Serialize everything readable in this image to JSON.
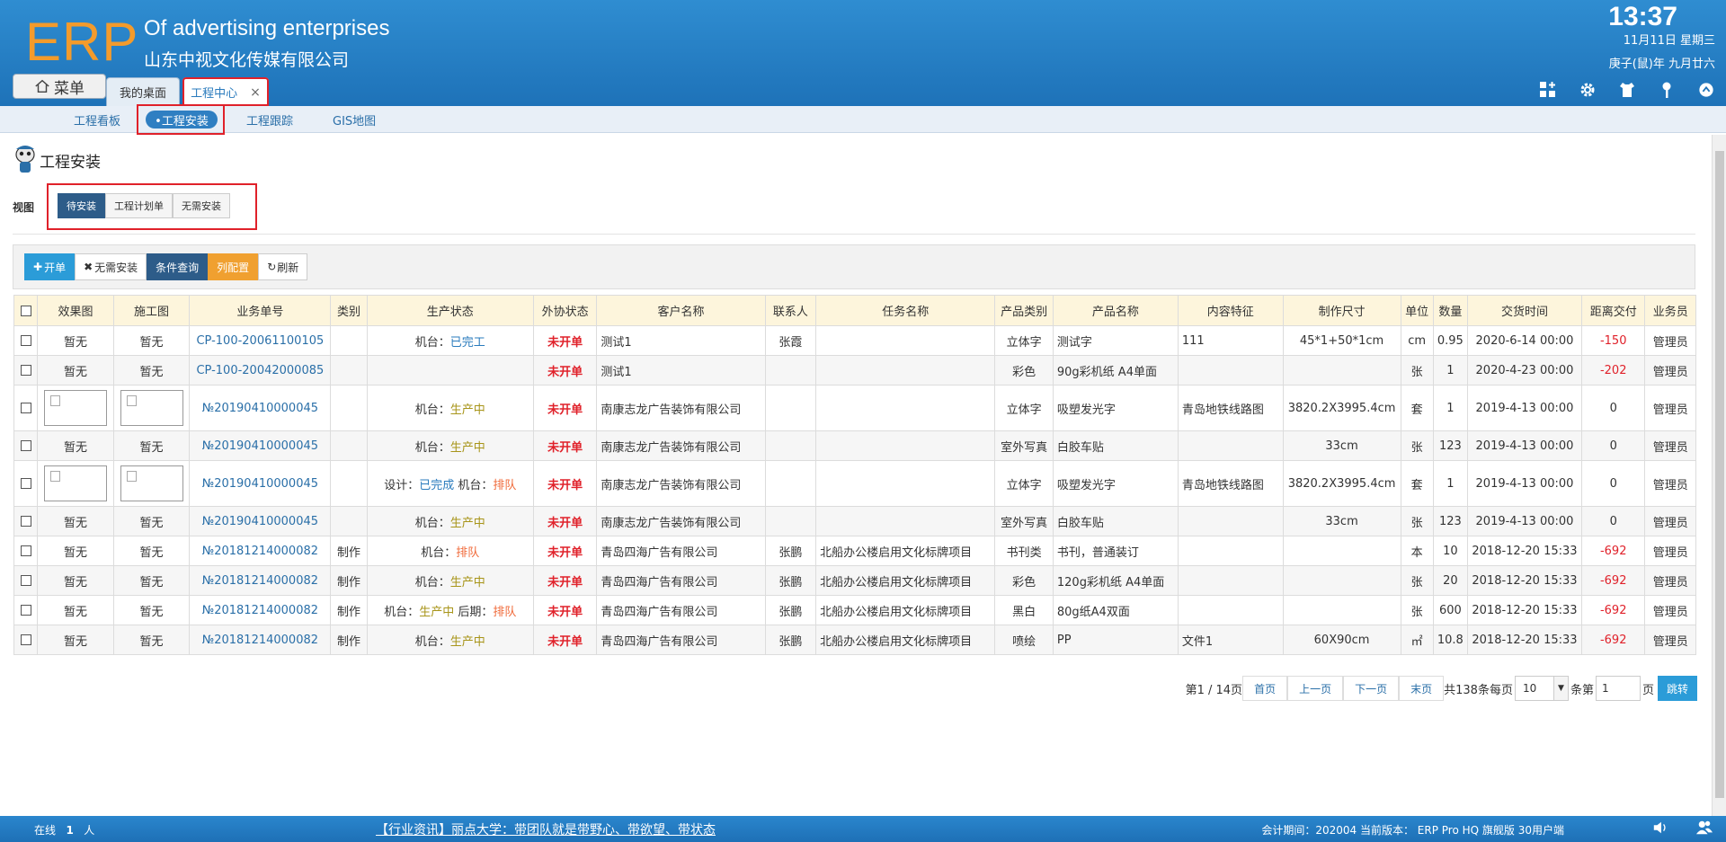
{
  "header": {
    "logo": "ERP",
    "company_en": "Of advertising enterprises",
    "company_cn": "山东中视文化传媒有限公司",
    "time": "13:37",
    "date_line1": "11月11日 星期三",
    "date_line2": "庚子(鼠)年 九月廿六",
    "menu_label": "菜单",
    "tabs": [
      {
        "label": "我的桌面"
      },
      {
        "label": "工程中心",
        "close": "×"
      }
    ],
    "icons": [
      "grid-add-icon",
      "gear-icon",
      "shirt-icon",
      "key-icon",
      "chevron-up-icon"
    ]
  },
  "subnav": {
    "items": [
      "工程看板",
      "•工程安装",
      "工程跟踪",
      "GIS地图"
    ],
    "active_index": 1
  },
  "page": {
    "title": "工程安装",
    "view_label": "视图",
    "views": [
      "待安装",
      "工程计划单",
      "无需安装"
    ],
    "active_view": 0
  },
  "toolbar": {
    "open": "开单",
    "no_install": "无需安装",
    "query": "条件查询",
    "columns": "列配置",
    "refresh": "刷新"
  },
  "table": {
    "headers": [
      "效果图",
      "施工图",
      "业务单号",
      "类别",
      "生产状态",
      "外协状态",
      "客户名称",
      "联系人",
      "任务名称",
      "产品类别",
      "产品名称",
      "内容特征",
      "制作尺寸",
      "单位",
      "数量",
      "交货时间",
      "距离交付",
      "业务员"
    ],
    "rows": [
      {
        "effect": "暂无",
        "construct": "暂无",
        "order": "CP-100-20061100105",
        "cat": "",
        "status_parts": [
          {
            "t": "机台：",
            "c": ""
          },
          {
            "t": "已完工",
            "c": "blue"
          }
        ],
        "outsource": "未开单",
        "customer": "测试1",
        "contact": "张霞",
        "task": "",
        "pcat": "立体字",
        "pname": "测试字",
        "feature": "111",
        "size": "45*1+50*1cm",
        "unit": "cm",
        "qty": "0.95",
        "delivery": "2020-6-14 00:00",
        "days": "-150",
        "sales": "管理员"
      },
      {
        "effect": "暂无",
        "construct": "暂无",
        "order": "CP-100-20042000085",
        "cat": "",
        "status_parts": [],
        "outsource": "未开单",
        "customer": "测试1",
        "contact": "",
        "task": "",
        "pcat": "彩色",
        "pname": "90g彩机纸 A4单面",
        "feature": "",
        "size": "",
        "unit": "张",
        "qty": "1",
        "delivery": "2020-4-23 00:00",
        "days": "-202",
        "sales": "管理员"
      },
      {
        "effect": "",
        "construct": "",
        "thumbs": true,
        "order": "№20190410000045",
        "cat": "",
        "status_parts": [
          {
            "t": "机台：",
            "c": ""
          },
          {
            "t": "生产中",
            "c": "olive"
          }
        ],
        "outsource": "未开单",
        "customer": "南康志龙广告装饰有限公司",
        "contact": "",
        "task": "",
        "pcat": "立体字",
        "pname": "吸塑发光字",
        "feature": "青岛地铁线路图",
        "size": "3820.2X3995.4cm",
        "unit": "套",
        "qty": "1",
        "delivery": "2019-4-13 00:00",
        "days": "0",
        "sales": "管理员"
      },
      {
        "effect": "暂无",
        "construct": "暂无",
        "order": "№20190410000045",
        "cat": "",
        "status_parts": [
          {
            "t": "机台：",
            "c": ""
          },
          {
            "t": "生产中",
            "c": "olive"
          }
        ],
        "outsource": "未开单",
        "customer": "南康志龙广告装饰有限公司",
        "contact": "",
        "task": "",
        "pcat": "室外写真",
        "pname": "白胶车贴",
        "feature": "",
        "size": "33cm",
        "unit": "张",
        "qty": "123",
        "delivery": "2019-4-13 00:00",
        "days": "0",
        "sales": "管理员"
      },
      {
        "effect": "",
        "construct": "",
        "thumbs": true,
        "order": "№20190410000045",
        "cat": "",
        "status_parts": [
          {
            "t": "设计：",
            "c": ""
          },
          {
            "t": "已完成",
            "c": "blue"
          },
          {
            "t": " 机台：",
            "c": ""
          },
          {
            "t": "排队",
            "c": "orange"
          }
        ],
        "outsource": "未开单",
        "customer": "南康志龙广告装饰有限公司",
        "contact": "",
        "task": "",
        "pcat": "立体字",
        "pname": "吸塑发光字",
        "feature": "青岛地铁线路图",
        "size": "3820.2X3995.4cm",
        "unit": "套",
        "qty": "1",
        "delivery": "2019-4-13 00:00",
        "days": "0",
        "sales": "管理员"
      },
      {
        "effect": "暂无",
        "construct": "暂无",
        "order": "№20190410000045",
        "cat": "",
        "status_parts": [
          {
            "t": "机台：",
            "c": ""
          },
          {
            "t": "生产中",
            "c": "olive"
          }
        ],
        "outsource": "未开单",
        "customer": "南康志龙广告装饰有限公司",
        "contact": "",
        "task": "",
        "pcat": "室外写真",
        "pname": "白胶车贴",
        "feature": "",
        "size": "33cm",
        "unit": "张",
        "qty": "123",
        "delivery": "2019-4-13 00:00",
        "days": "0",
        "sales": "管理员"
      },
      {
        "effect": "暂无",
        "construct": "暂无",
        "order": "№20181214000082",
        "cat": "制作",
        "status_parts": [
          {
            "t": "机台：",
            "c": ""
          },
          {
            "t": "排队",
            "c": "orange"
          }
        ],
        "outsource": "未开单",
        "customer": "青岛四海广告有限公司",
        "contact": "张鹏",
        "task": "北船办公楼启用文化标牌项目",
        "pcat": "书刊类",
        "pname": "书刊，普通装订",
        "feature": "",
        "size": "",
        "unit": "本",
        "qty": "10",
        "delivery": "2018-12-20 15:33",
        "days": "-692",
        "sales": "管理员"
      },
      {
        "effect": "暂无",
        "construct": "暂无",
        "order": "№20181214000082",
        "cat": "制作",
        "status_parts": [
          {
            "t": "机台：",
            "c": ""
          },
          {
            "t": "生产中",
            "c": "olive"
          }
        ],
        "outsource": "未开单",
        "customer": "青岛四海广告有限公司",
        "contact": "张鹏",
        "task": "北船办公楼启用文化标牌项目",
        "pcat": "彩色",
        "pname": "120g彩机纸 A4单面",
        "feature": "",
        "size": "",
        "unit": "张",
        "qty": "20",
        "delivery": "2018-12-20 15:33",
        "days": "-692",
        "sales": "管理员"
      },
      {
        "effect": "暂无",
        "construct": "暂无",
        "order": "№20181214000082",
        "cat": "制作",
        "status_parts": [
          {
            "t": "机台：",
            "c": ""
          },
          {
            "t": "生产中",
            "c": "olive"
          },
          {
            "t": " 后期：",
            "c": ""
          },
          {
            "t": "排队",
            "c": "orange"
          }
        ],
        "outsource": "未开单",
        "customer": "青岛四海广告有限公司",
        "contact": "张鹏",
        "task": "北船办公楼启用文化标牌项目",
        "pcat": "黑白",
        "pname": "80g纸A4双面",
        "feature": "",
        "size": "",
        "unit": "张",
        "qty": "600",
        "delivery": "2018-12-20 15:33",
        "days": "-692",
        "sales": "管理员"
      },
      {
        "effect": "暂无",
        "construct": "暂无",
        "order": "№20181214000082",
        "cat": "制作",
        "status_parts": [
          {
            "t": "机台：",
            "c": ""
          },
          {
            "t": "生产中",
            "c": "olive"
          }
        ],
        "outsource": "未开单",
        "customer": "青岛四海广告有限公司",
        "contact": "张鹏",
        "task": "北船办公楼启用文化标牌项目",
        "pcat": "喷绘",
        "pname": "PP",
        "feature": "文件1",
        "size": "60X90cm",
        "unit": "㎡",
        "qty": "10.8",
        "delivery": "2018-12-20 15:33",
        "days": "-692",
        "sales": "管理员"
      }
    ]
  },
  "pager": {
    "page_info": "第1 / 14页",
    "first": "首页",
    "prev": "上一页",
    "next": "下一页",
    "last": "末页",
    "total": "共138条每页",
    "per_page": "10",
    "goto_prefix": "条第",
    "goto_value": "1",
    "goto_suffix": "页",
    "go": "跳转"
  },
  "footer": {
    "online_label": "在线",
    "online_count": "1",
    "online_unit": "人",
    "news": "【行业资讯】丽点大学：带团队就是带野心、带欲望、带状态",
    "version": "会计期间：202004 当前版本： ERP Pro HQ 旗舰版 30用户端"
  },
  "colors": {
    "header_blue": "#1e72b8",
    "logo_orange": "#f39b2c",
    "highlight_red": "#e0212a",
    "table_header": "#fdf5dc",
    "active_view": "#2d5c89"
  }
}
